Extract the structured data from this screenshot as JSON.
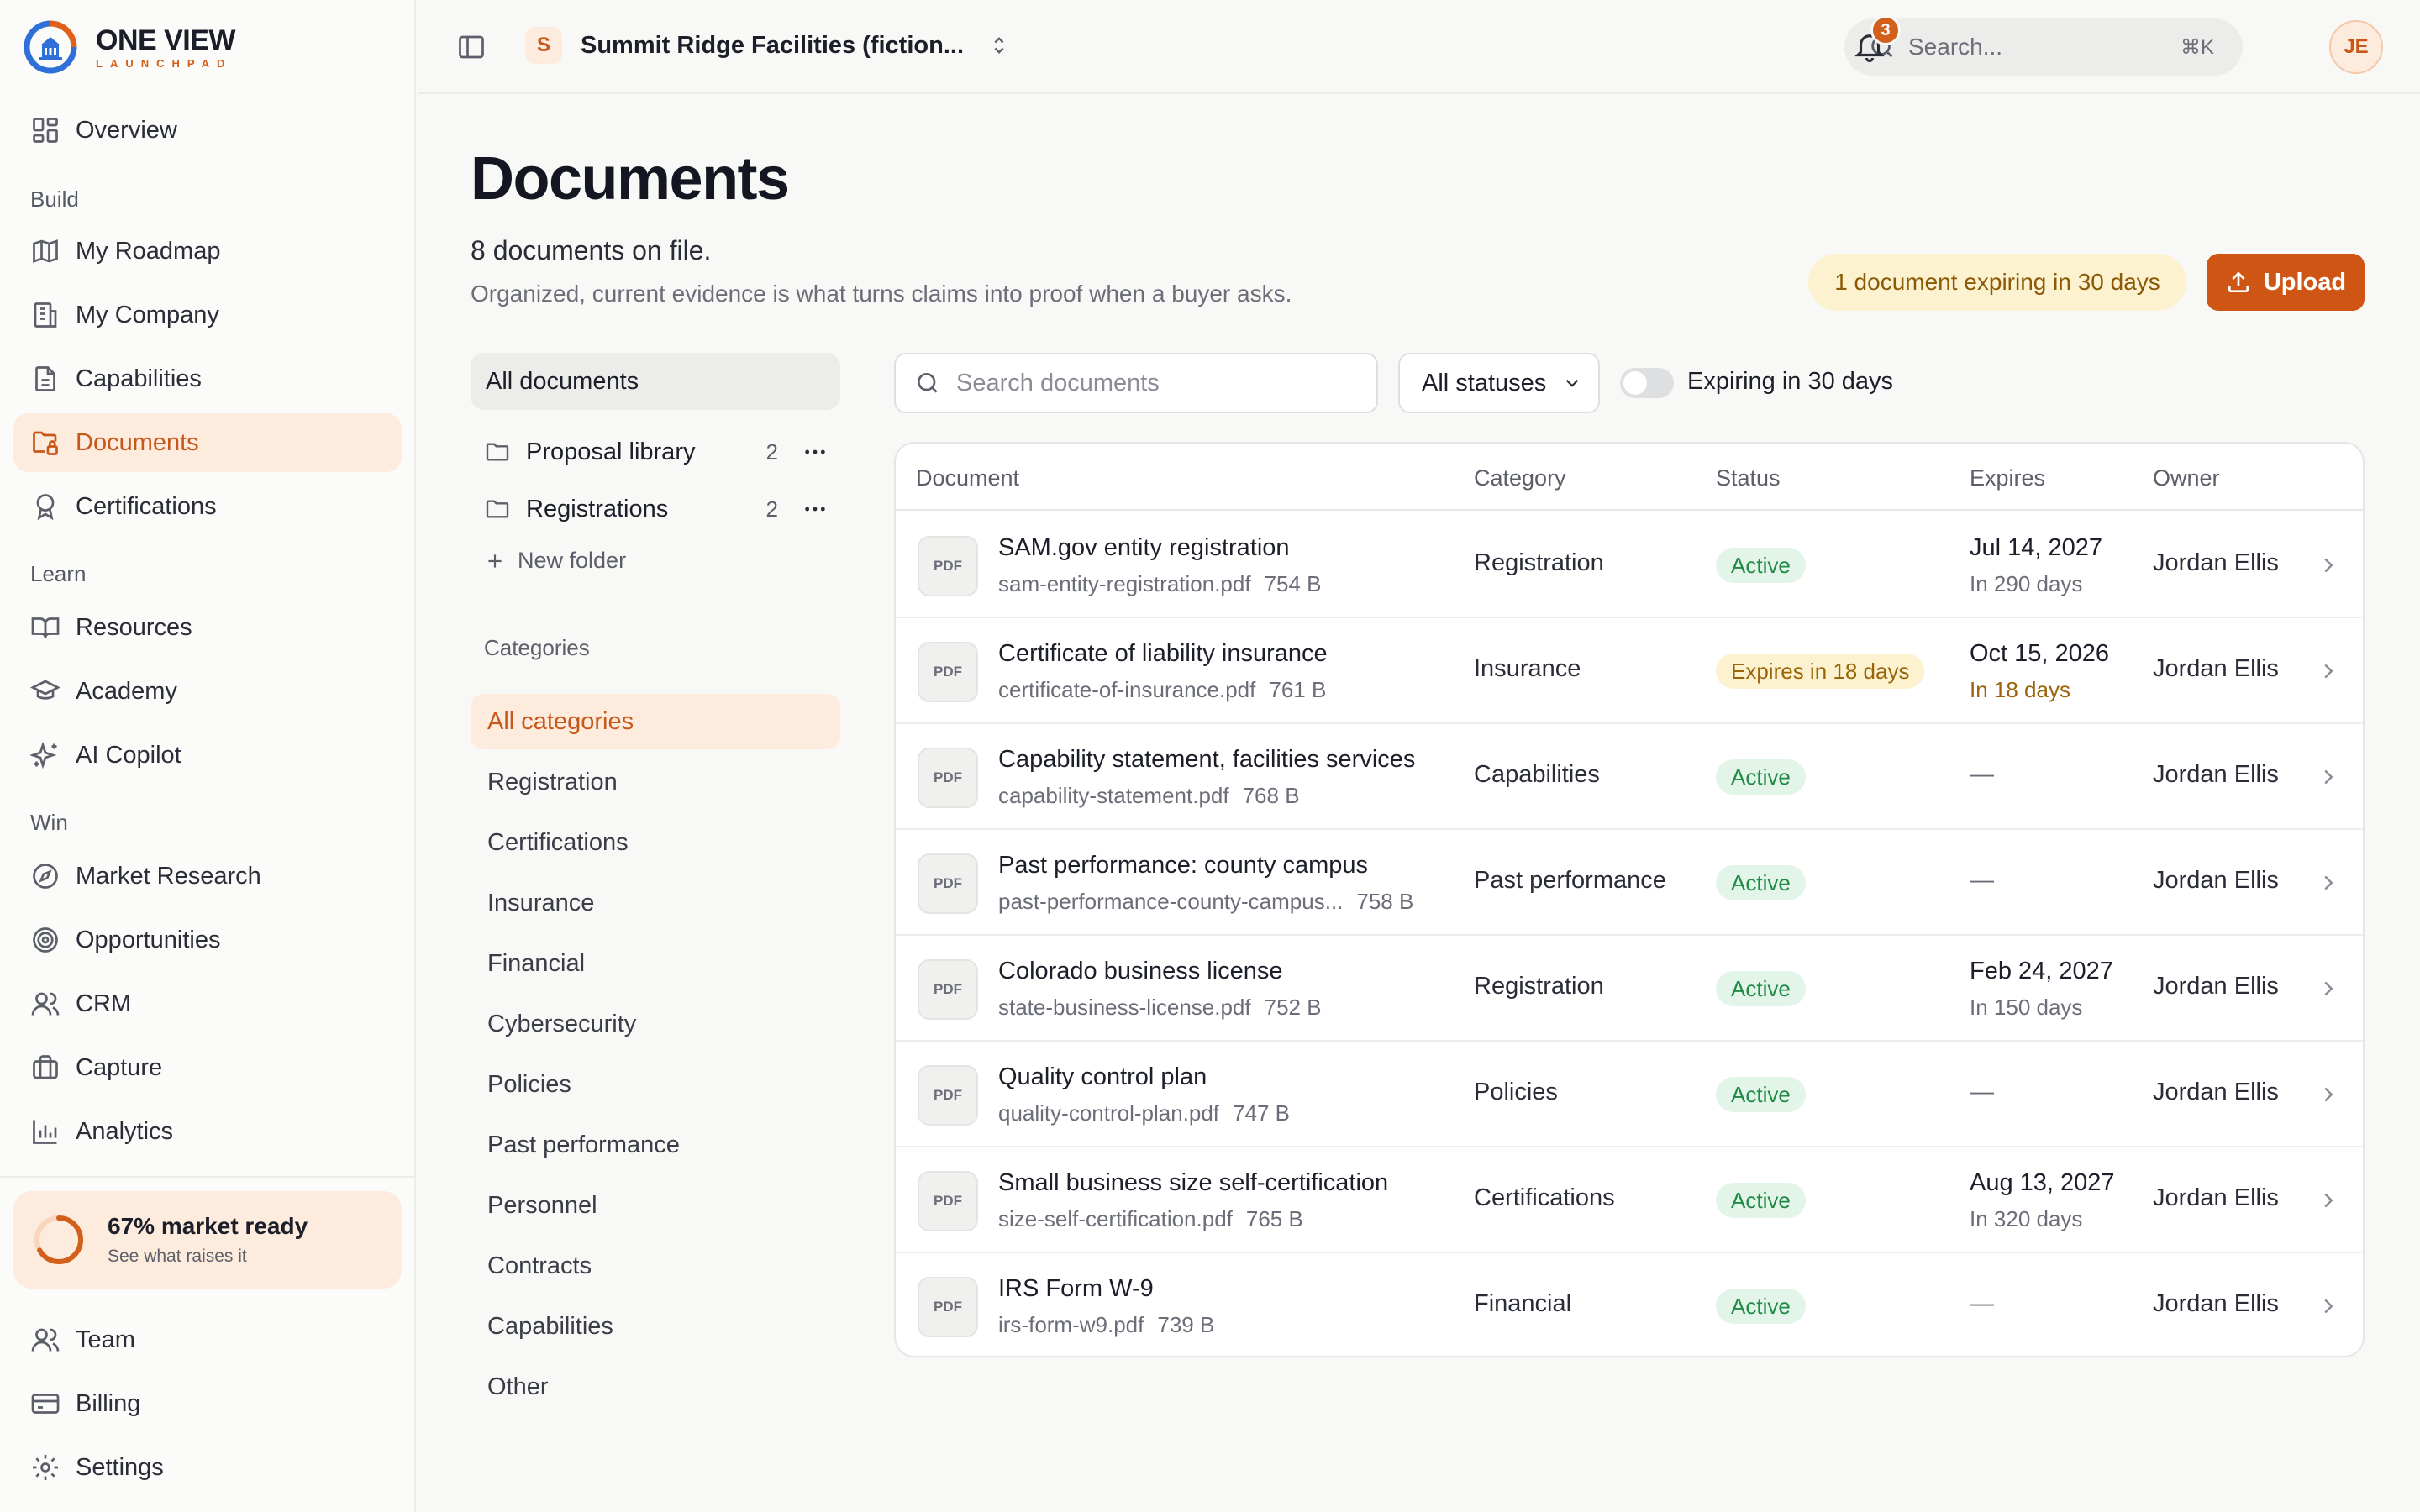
{
  "brand": {
    "name": "ONE VIEW",
    "sub": "LAUNCHPAD",
    "accent": "#cf5515"
  },
  "sidebar": {
    "overview": "Overview",
    "sections": {
      "build": "Build",
      "learn": "Learn",
      "win": "Win"
    },
    "build_items": [
      "My Roadmap",
      "My Company",
      "Capabilities",
      "Documents",
      "Certifications"
    ],
    "learn_items": [
      "Resources",
      "Academy",
      "AI Copilot"
    ],
    "win_items": [
      "Market Research",
      "Opportunities",
      "CRM",
      "Capture",
      "Analytics"
    ],
    "readiness": {
      "title": "67% market ready",
      "sub": "See what raises it",
      "percent": 67
    },
    "footer_items": [
      "Team",
      "Billing",
      "Settings"
    ]
  },
  "topbar": {
    "org_initial": "S",
    "org_name": "Summit Ridge Facilities (fiction...",
    "search_placeholder": "Search...",
    "search_shortcut": "⌘K",
    "notifications": "3",
    "user_initials": "JE"
  },
  "header": {
    "title": "Documents",
    "count": "8 documents on file.",
    "description": "Organized, current evidence is what turns claims into proof when a buyer asks.",
    "expiring_notice": "1 document expiring in 30 days",
    "upload_label": "Upload"
  },
  "filters": {
    "all_documents": "All documents",
    "folders": [
      {
        "name": "Proposal library",
        "count": "2"
      },
      {
        "name": "Registrations",
        "count": "2"
      }
    ],
    "new_folder": "New folder",
    "categories_heading": "Categories",
    "categories": [
      "All categories",
      "Registration",
      "Certifications",
      "Insurance",
      "Financial",
      "Cybersecurity",
      "Policies",
      "Past performance",
      "Personnel",
      "Contracts",
      "Capabilities",
      "Other"
    ],
    "search_placeholder": "Search documents",
    "status_select": "All statuses",
    "toggle_label": "Expiring in 30 days"
  },
  "table": {
    "columns": [
      "Document",
      "Category",
      "Status",
      "Expires",
      "Owner"
    ],
    "file_type": "PDF",
    "rows": [
      {
        "name": "SAM.gov entity registration",
        "file": "sam-entity-registration.pdf",
        "size": "754 B",
        "category": "Registration",
        "status": "Active",
        "expires": "Jul 14, 2027",
        "relative": "In 290 days",
        "owner": "Jordan Ellis"
      },
      {
        "name": "Certificate of liability insurance",
        "file": "certificate-of-insurance.pdf",
        "size": "761 B",
        "category": "Insurance",
        "status": "Expires in 18 days",
        "expires": "Oct 15, 2026",
        "relative": "In 18 days",
        "owner": "Jordan Ellis"
      },
      {
        "name": "Capability statement, facilities services",
        "file": "capability-statement.pdf",
        "size": "768 B",
        "category": "Capabilities",
        "status": "Active",
        "expires": "—",
        "relative": "",
        "owner": "Jordan Ellis"
      },
      {
        "name": "Past performance: county campus",
        "file": "past-performance-county-campus...",
        "size": "758 B",
        "category": "Past performance",
        "status": "Active",
        "expires": "—",
        "relative": "",
        "owner": "Jordan Ellis"
      },
      {
        "name": "Colorado business license",
        "file": "state-business-license.pdf",
        "size": "752 B",
        "category": "Registration",
        "status": "Active",
        "expires": "Feb 24, 2027",
        "relative": "In 150 days",
        "owner": "Jordan Ellis"
      },
      {
        "name": "Quality control plan",
        "file": "quality-control-plan.pdf",
        "size": "747 B",
        "category": "Policies",
        "status": "Active",
        "expires": "—",
        "relative": "",
        "owner": "Jordan Ellis"
      },
      {
        "name": "Small business size self-certification",
        "file": "size-self-certification.pdf",
        "size": "765 B",
        "category": "Certifications",
        "status": "Active",
        "expires": "Aug 13, 2027",
        "relative": "In 320 days",
        "owner": "Jordan Ellis"
      },
      {
        "name": "IRS Form W-9",
        "file": "irs-form-w9.pdf",
        "size": "739 B",
        "category": "Financial",
        "status": "Active",
        "expires": "—",
        "relative": "",
        "owner": "Jordan Ellis"
      }
    ]
  }
}
